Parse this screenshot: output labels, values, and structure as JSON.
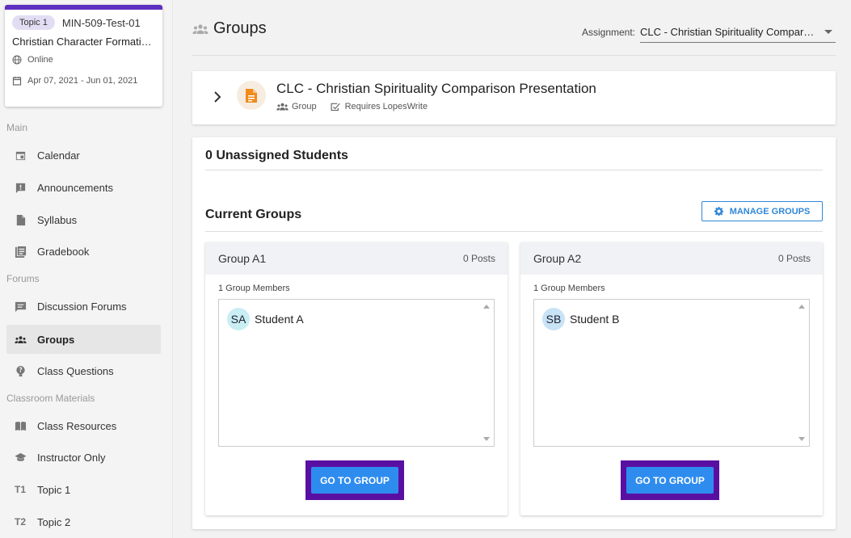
{
  "course": {
    "topic_badge": "Topic 1",
    "code": "MIN-509-Test-01",
    "name": "Christian Character Formati…",
    "modality": "Online",
    "dates": "Apr 07, 2021 - Jun 01, 2021",
    "accent_color": "#5d2fc1"
  },
  "sidebar": {
    "sections": [
      {
        "label": "Main"
      },
      {
        "label": "Forums"
      },
      {
        "label": "Classroom Materials"
      }
    ],
    "items": [
      {
        "label": "Calendar",
        "icon": "calendar-icon"
      },
      {
        "label": "Announcements",
        "icon": "announcement-icon"
      },
      {
        "label": "Syllabus",
        "icon": "document-icon"
      },
      {
        "label": "Gradebook",
        "icon": "gradebook-icon"
      },
      {
        "label": "Discussion Forums",
        "icon": "forum-icon"
      },
      {
        "label": "Groups",
        "icon": "groups-icon",
        "active": true
      },
      {
        "label": "Class Questions",
        "icon": "question-icon"
      },
      {
        "label": "Class Resources",
        "icon": "book-icon"
      },
      {
        "label": "Instructor Only",
        "icon": "graduation-cap-icon"
      },
      {
        "label": "Topic 1",
        "icon_text": "T1"
      },
      {
        "label": "Topic 2",
        "icon_text": "T2"
      }
    ]
  },
  "header": {
    "title": "Groups",
    "assignment_label": "Assignment:",
    "assignment_value": "CLC - Christian Spirituality Compari…"
  },
  "assignment": {
    "title": "CLC - Christian Spirituality Comparison Presentation",
    "type": "Group",
    "requirement": "Requires LopesWrite",
    "icon_color": "#f08a1c"
  },
  "groups_panel": {
    "unassigned": "0 Unassigned Students",
    "current_title": "Current Groups",
    "manage_label": "MANAGE GROUPS",
    "groups": [
      {
        "name": "Group A1",
        "posts": "0 Posts",
        "members_label": "1 Group Members",
        "members": [
          {
            "initials": "SA",
            "name": "Student A",
            "avatar_color": "#c9eef3"
          }
        ],
        "go_label": "GO TO GROUP"
      },
      {
        "name": "Group A2",
        "posts": "0 Posts",
        "members_label": "1 Group Members",
        "members": [
          {
            "initials": "SB",
            "name": "Student B",
            "avatar_color": "#c8e3f6"
          }
        ],
        "go_label": "GO TO GROUP"
      }
    ]
  },
  "colors": {
    "primary_blue": "#2f8cef",
    "highlight_purple": "#5a0fa3"
  }
}
